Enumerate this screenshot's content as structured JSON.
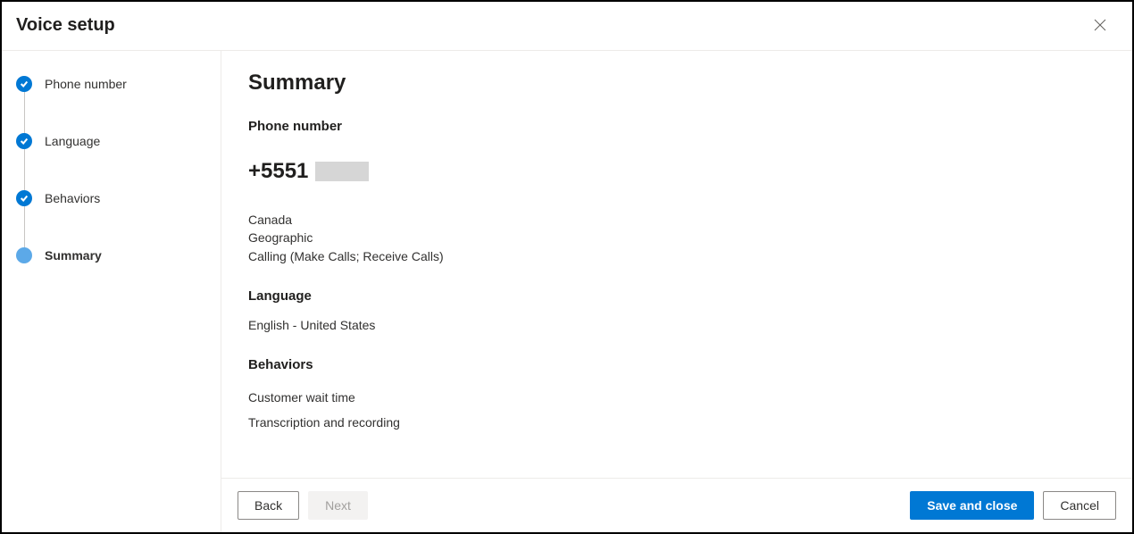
{
  "dialog": {
    "title": "Voice setup"
  },
  "steps": [
    {
      "label": "Phone number",
      "state": "completed"
    },
    {
      "label": "Language",
      "state": "completed"
    },
    {
      "label": "Behaviors",
      "state": "completed"
    },
    {
      "label": "Summary",
      "state": "current"
    }
  ],
  "summary": {
    "heading": "Summary",
    "phone": {
      "section_label": "Phone number",
      "prefix": "+5551",
      "country": "Canada",
      "type": "Geographic",
      "capabilities": "Calling (Make Calls; Receive Calls)"
    },
    "language": {
      "section_label": "Language",
      "value": "English - United States"
    },
    "behaviors": {
      "section_label": "Behaviors",
      "items": [
        "Customer wait time",
        "Transcription and recording"
      ]
    }
  },
  "footer": {
    "back": "Back",
    "next": "Next",
    "save": "Save and close",
    "cancel": "Cancel"
  }
}
